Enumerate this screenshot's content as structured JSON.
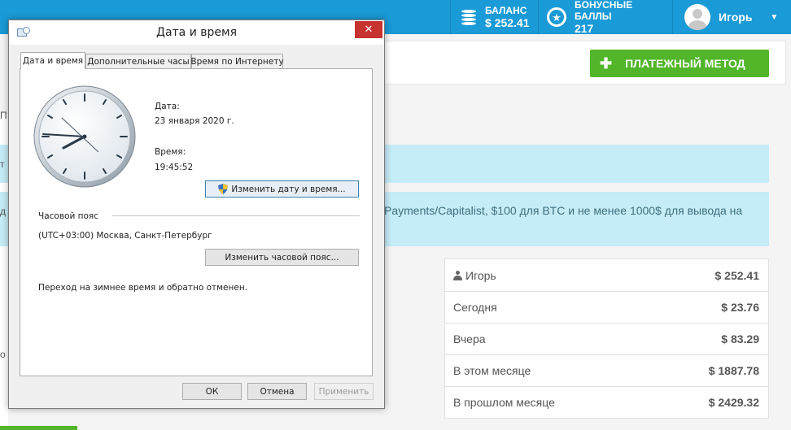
{
  "web": {
    "balance": {
      "label": "БАЛАНС",
      "value": "$ 252.41"
    },
    "bonus": {
      "label": "БОНУСНЫЕ БАЛЛЫ",
      "value": "217"
    },
    "user": {
      "name": "Игорь"
    },
    "pay_button": {
      "label": "ПЛАТЕЖНЫЙ МЕТОД"
    },
    "notice_text": "Payments/Capitalist, $100 для BTC и не менее 1000$ для вывода на",
    "edge_chars": {
      "row1": "П",
      "row2": "т",
      "row3": "д",
      "row4": "о"
    },
    "stats": [
      {
        "label": "Игорь",
        "value": "$ 252.41",
        "icon": "user-icon"
      },
      {
        "label": "Сегодня",
        "value": "$ 23.76"
      },
      {
        "label": "Вчера",
        "value": "$ 83.29"
      },
      {
        "label": "В этом месяце",
        "value": "$ 1887.78"
      },
      {
        "label": "В прошлом месяце",
        "value": "$ 2429.32"
      }
    ],
    "colors": {
      "topbar": "#1a9ad6",
      "accent_green": "#52b52a",
      "info_bg": "#c5ecf7"
    }
  },
  "dialog": {
    "title": "Дата и время",
    "tabs": [
      {
        "label": "Дата и время",
        "active": true
      },
      {
        "label": "Дополнительные часы",
        "active": false
      },
      {
        "label": "Время по Интернету",
        "active": false
      }
    ],
    "date_label": "Дата:",
    "date_value": "23 января 2020 г.",
    "time_label": "Время:",
    "time_value": "19:45:52",
    "change_datetime_button": "Изменить дату и время...",
    "timezone_group": "Часовой пояс",
    "timezone_value": "(UTC+03:00) Москва, Санкт-Петербург",
    "change_timezone_button": "Изменить часовой пояс...",
    "dst_note": "Переход на зимнее время и обратно отменен.",
    "footer": {
      "ok": "ОК",
      "cancel": "Отмена",
      "apply": "Применить"
    }
  }
}
